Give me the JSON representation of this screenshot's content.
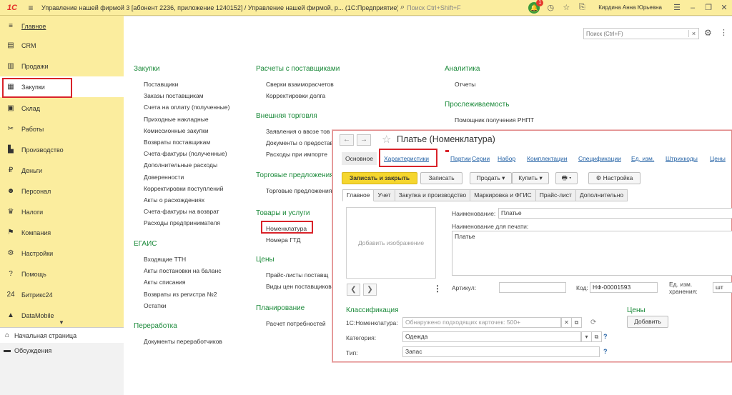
{
  "topbar": {
    "logo": "1С",
    "title": "Управление нашей фирмой 3 [абонент 2236, приложение 1240152] / Управление нашей фирмой, р...",
    "platform": "(1С:Предприятие)",
    "search_placeholder": "Поиск Ctrl+Shift+F",
    "notifications_count": "1",
    "user": "Кирдина Анна Юрьевна"
  },
  "sidebar": {
    "items": [
      {
        "icon": "menu-icon",
        "glyph": "≡",
        "label": "Главное"
      },
      {
        "icon": "crm-icon",
        "glyph": "▤",
        "label": "CRM"
      },
      {
        "icon": "sales-icon",
        "glyph": "▥",
        "label": "Продажи"
      },
      {
        "icon": "purchases-icon",
        "glyph": "▦",
        "label": "Закупки"
      },
      {
        "icon": "warehouse-icon",
        "glyph": "▣",
        "label": "Склад"
      },
      {
        "icon": "works-icon",
        "glyph": "✂",
        "label": "Работы"
      },
      {
        "icon": "production-icon",
        "glyph": "▙",
        "label": "Производство"
      },
      {
        "icon": "money-icon",
        "glyph": "₽",
        "label": "Деньги"
      },
      {
        "icon": "personnel-icon",
        "glyph": "☻",
        "label": "Персонал"
      },
      {
        "icon": "taxes-icon",
        "glyph": "♛",
        "label": "Налоги"
      },
      {
        "icon": "company-icon",
        "glyph": "⚑",
        "label": "Компания"
      },
      {
        "icon": "settings-icon",
        "glyph": "⚙",
        "label": "Настройки"
      },
      {
        "icon": "help-icon",
        "glyph": "?",
        "label": "Помощь"
      },
      {
        "icon": "bitrix-icon",
        "glyph": "24",
        "label": "Битрикс24"
      },
      {
        "icon": "datamobile-icon",
        "glyph": "▲",
        "label": "DataMobile"
      }
    ],
    "bottom": [
      {
        "icon": "home-icon",
        "glyph": "⌂",
        "label": "Начальная страница"
      },
      {
        "icon": "chat-icon",
        "glyph": "▬",
        "label": "Обсуждения"
      }
    ]
  },
  "main": {
    "search_placeholder": "Поиск (Ctrl+F)",
    "columns": [
      {
        "sections": [
          {
            "title": "Закупки",
            "links": [
              "Поставщики",
              "Заказы поставщикам",
              "Счета на оплату (полученные)",
              "Приходные накладные",
              "Комиссионные закупки",
              "Возвраты поставщикам",
              "Счета-фактуры (полученные)",
              "Дополнительные расходы",
              "Доверенности",
              "Корректировки поступлений",
              "Акты о расхождениях",
              "Счета-фактуры на возврат",
              "Расходы предпринимателя"
            ]
          },
          {
            "title": "ЕГАИС",
            "links": [
              "Входящие ТТН",
              "Акты постановки на баланс",
              "Акты списания",
              "Возвраты из регистра №2",
              "Остатки"
            ]
          },
          {
            "title": "Переработка",
            "links": [
              "Документы переработчиков"
            ]
          }
        ]
      },
      {
        "sections": [
          {
            "title": "Расчеты с поставщиками",
            "links": [
              "Сверки взаиморасчетов",
              "Корректировки долга"
            ]
          },
          {
            "title": "Внешняя торговля",
            "links": [
              "Заявления о ввозе тов",
              "Документы о предостав",
              "Расходы при импорте"
            ]
          },
          {
            "title": "Торговые предложения",
            "links": [
              "Торговые предложения"
            ]
          },
          {
            "title": "Товары и услуги",
            "links": [
              "Номенклатура",
              "Номера ГТД"
            ]
          },
          {
            "title": "Цены",
            "links": [
              "Прайс-листы поставщ",
              "Виды цен поставщиков"
            ]
          },
          {
            "title": "Планирование",
            "links": [
              "Расчет потребностей"
            ]
          }
        ]
      },
      {
        "sections": [
          {
            "title": "Аналитика",
            "links": [
              "Отчеты"
            ]
          },
          {
            "title": "Прослеживаемость",
            "links": [
              "Помощник получения РНПТ"
            ]
          }
        ]
      }
    ]
  },
  "form": {
    "title": "Платье (Номенклатура)",
    "tabs": [
      "Основное",
      "Характеристики",
      "Партии",
      "Серии",
      "Набор",
      "Комплектации",
      "Спецификации",
      "Ед. изм.",
      "Штрихкоды",
      "Цены"
    ],
    "toolbar": {
      "save_close": "Записать и закрыть",
      "save": "Записать",
      "sell": "Продать",
      "buy": "Купить",
      "print": "▾",
      "settings": "Настройка"
    },
    "subtabs": [
      "Главное",
      "Учет",
      "Закупка и производство",
      "Маркировка и ФГИС",
      "Прайс-лист",
      "Дополнительно"
    ],
    "image_placeholder": "Добавить изображение",
    "name_label": "Наименование:",
    "name_value": "Платье",
    "print_name_label": "Наименование для печати:",
    "print_name_value": "Платье",
    "article_label": "Артикул:",
    "article_value": "",
    "code_label": "Код:",
    "code_value": "НФ-00001593",
    "unit_label_1": "Ед. изм.",
    "unit_label_2": "хранения:",
    "unit_value": "шт",
    "classification_title": "Классификация",
    "nomenclature_label": "1С:Номенклатура:",
    "nomenclature_placeholder": "Обнаружено подходящих карточек: 500+",
    "category_label": "Категория:",
    "category_value": "Одежда",
    "type_label": "Тип:",
    "type_value": "Запас",
    "prices_title": "Цены",
    "add_price": "Добавить"
  },
  "highlight_color": "#d9232a",
  "section_color": "#1b8a3a",
  "link_color": "#2563a6"
}
